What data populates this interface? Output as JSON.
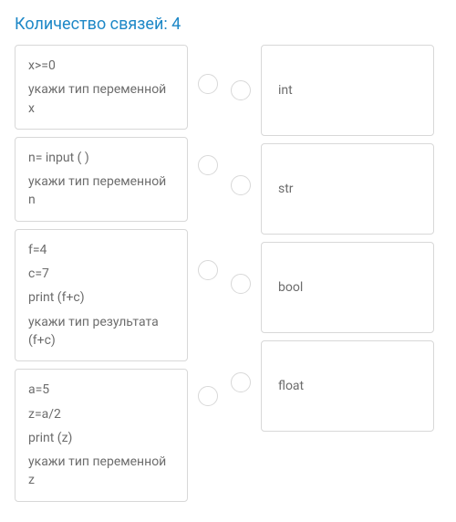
{
  "title": "Количество связей: 4",
  "left_items": [
    {
      "lines": [
        "x>=0",
        "укажи тип переменной x"
      ]
    },
    {
      "lines": [
        "n= input ( )",
        "укажи тип переменной n"
      ]
    },
    {
      "lines": [
        "f=4",
        "c=7",
        "print (f+c)",
        "укажи тип результата (f+c)"
      ]
    },
    {
      "lines": [
        "a=5",
        "z=a/2",
        "print (z)",
        "укажи тип переменной z"
      ]
    }
  ],
  "right_items": [
    {
      "label": "int"
    },
    {
      "label": "str"
    },
    {
      "label": "bool"
    },
    {
      "label": "float"
    }
  ]
}
